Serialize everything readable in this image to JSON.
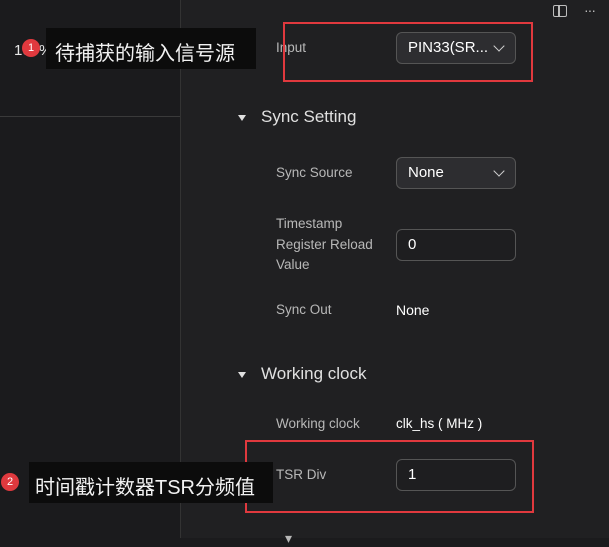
{
  "left": {
    "zoom": "100%"
  },
  "fields": {
    "input_label": "Input",
    "input_value": "PIN33(SR...",
    "sync_section": "Sync Setting",
    "sync_source_label": "Sync Source",
    "sync_source_value": "None",
    "ts_label_1": "Timestamp",
    "ts_label_2": "Register Reload",
    "ts_label_3": "Value",
    "ts_value": "0",
    "sync_out_label": "Sync Out",
    "sync_out_value": "None",
    "clock_section": "Working clock",
    "working_clock_label": "Working clock",
    "working_clock_value": "clk_hs ( MHz )",
    "tsr_label": "TSR Div",
    "tsr_value": "1"
  },
  "annotations": [
    {
      "number": "1",
      "text": "待捕获的输入信号源"
    },
    {
      "number": "2",
      "text": "时间戳计数器TSR分频值"
    }
  ],
  "colors": {
    "highlight": "#e0393e",
    "background": "#202022"
  }
}
